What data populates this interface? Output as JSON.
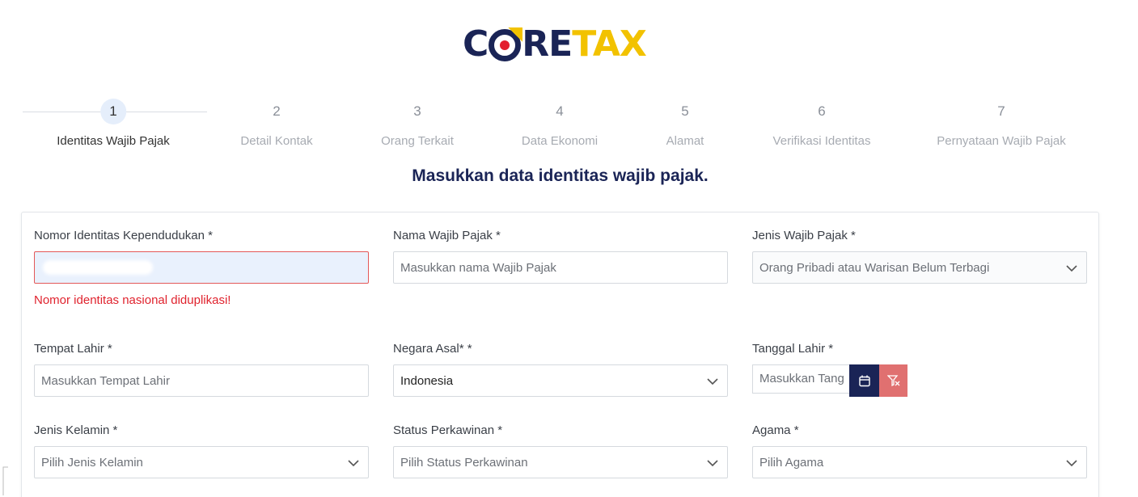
{
  "logo": {
    "part1": "C",
    "part2": "RE",
    "part3": "TAX"
  },
  "steps": [
    {
      "num": "1",
      "label": "Identitas Wajib Pajak"
    },
    {
      "num": "2",
      "label": "Detail Kontak"
    },
    {
      "num": "3",
      "label": "Orang Terkait"
    },
    {
      "num": "4",
      "label": "Data Ekonomi"
    },
    {
      "num": "5",
      "label": "Alamat"
    },
    {
      "num": "6",
      "label": "Verifikasi Identitas"
    },
    {
      "num": "7",
      "label": "Pernyataan Wajib Pajak"
    }
  ],
  "heading": "Masukkan data identitas wajib pajak.",
  "form": {
    "nik": {
      "label": "Nomor Identitas Kependudukan *",
      "error": "Nomor identitas nasional diduplikasi!"
    },
    "nama": {
      "label": "Nama Wajib Pajak *",
      "placeholder": "Masukkan nama Wajib Pajak"
    },
    "jenis_wp": {
      "label": "Jenis Wajib Pajak *",
      "value": "Orang Pribadi atau Warisan Belum Terbagi"
    },
    "tempat_lahir": {
      "label": "Tempat Lahir *",
      "placeholder": "Masukkan Tempat Lahir"
    },
    "negara_asal": {
      "label": "Negara Asal* *",
      "value": "Indonesia"
    },
    "tanggal_lahir": {
      "label": "Tanggal Lahir *",
      "placeholder": "Masukkan Tang"
    },
    "jenis_kelamin": {
      "label": "Jenis Kelamin *",
      "placeholder": "Pilih Jenis Kelamin"
    },
    "status_kawin": {
      "label": "Status Perkawinan *",
      "placeholder": "Pilih Status Perkawinan"
    },
    "agama": {
      "label": "Agama *",
      "placeholder": "Pilih Agama"
    }
  },
  "colors": {
    "brand_navy": "#1a2456",
    "brand_gold": "#f2c200",
    "brand_red": "#e31e2d",
    "error": "#e0232e"
  },
  "icons": [
    "calendar-icon",
    "filter-clear-icon",
    "chevron-down-icon"
  ]
}
